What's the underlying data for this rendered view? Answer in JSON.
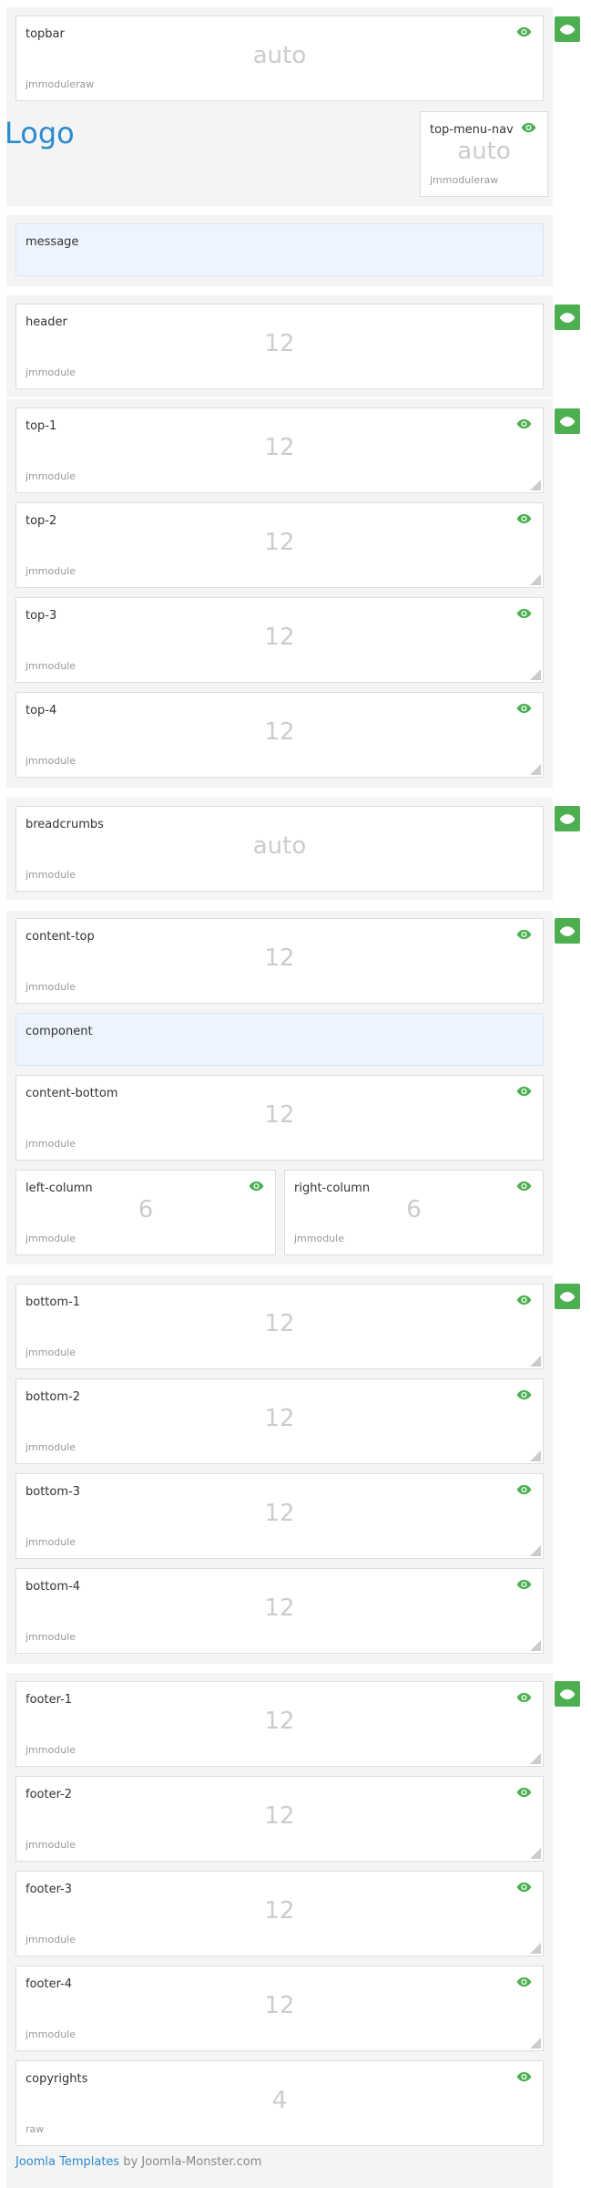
{
  "logo": "Logo",
  "icons": {
    "eye": "eye-icon",
    "resize": "resize-handle-icon"
  },
  "colors": {
    "accent": "#4caf50",
    "link": "#2a8bd0",
    "component_bg": "#eef4fd"
  },
  "positions": {
    "topbar": {
      "title": "topbar",
      "size": "auto",
      "type": "jmmoduleraw"
    },
    "top_menu_nav": {
      "title": "top-menu-nav",
      "size": "auto",
      "type": "jmmoduleraw"
    },
    "message": {
      "title": "message"
    },
    "header": {
      "title": "header",
      "size": "12",
      "type": "jmmodule"
    },
    "top_1": {
      "title": "top-1",
      "size": "12",
      "type": "jmmodule"
    },
    "top_2": {
      "title": "top-2",
      "size": "12",
      "type": "jmmodule"
    },
    "top_3": {
      "title": "top-3",
      "size": "12",
      "type": "jmmodule"
    },
    "top_4": {
      "title": "top-4",
      "size": "12",
      "type": "jmmodule"
    },
    "breadcrumbs": {
      "title": "breadcrumbs",
      "size": "auto",
      "type": "jmmodule"
    },
    "content_top": {
      "title": "content-top",
      "size": "12",
      "type": "jmmodule"
    },
    "component": {
      "title": "component"
    },
    "content_bottom": {
      "title": "content-bottom",
      "size": "12",
      "type": "jmmodule"
    },
    "left_column": {
      "title": "left-column",
      "size": "6",
      "type": "jmmodule"
    },
    "right_column": {
      "title": "right-column",
      "size": "6",
      "type": "jmmodule"
    },
    "bottom_1": {
      "title": "bottom-1",
      "size": "12",
      "type": "jmmodule"
    },
    "bottom_2": {
      "title": "bottom-2",
      "size": "12",
      "type": "jmmodule"
    },
    "bottom_3": {
      "title": "bottom-3",
      "size": "12",
      "type": "jmmodule"
    },
    "bottom_4": {
      "title": "bottom-4",
      "size": "12",
      "type": "jmmodule"
    },
    "footer_1": {
      "title": "footer-1",
      "size": "12",
      "type": "jmmodule"
    },
    "footer_2": {
      "title": "footer-2",
      "size": "12",
      "type": "jmmodule"
    },
    "footer_3": {
      "title": "footer-3",
      "size": "12",
      "type": "jmmodule"
    },
    "footer_4": {
      "title": "footer-4",
      "size": "12",
      "type": "jmmodule"
    },
    "copyrights": {
      "title": "copyrights",
      "size": "4",
      "type": "raw"
    }
  },
  "footer": {
    "link_text": "Joomla Templates",
    "rest": " by Joomla-Monster.com"
  }
}
